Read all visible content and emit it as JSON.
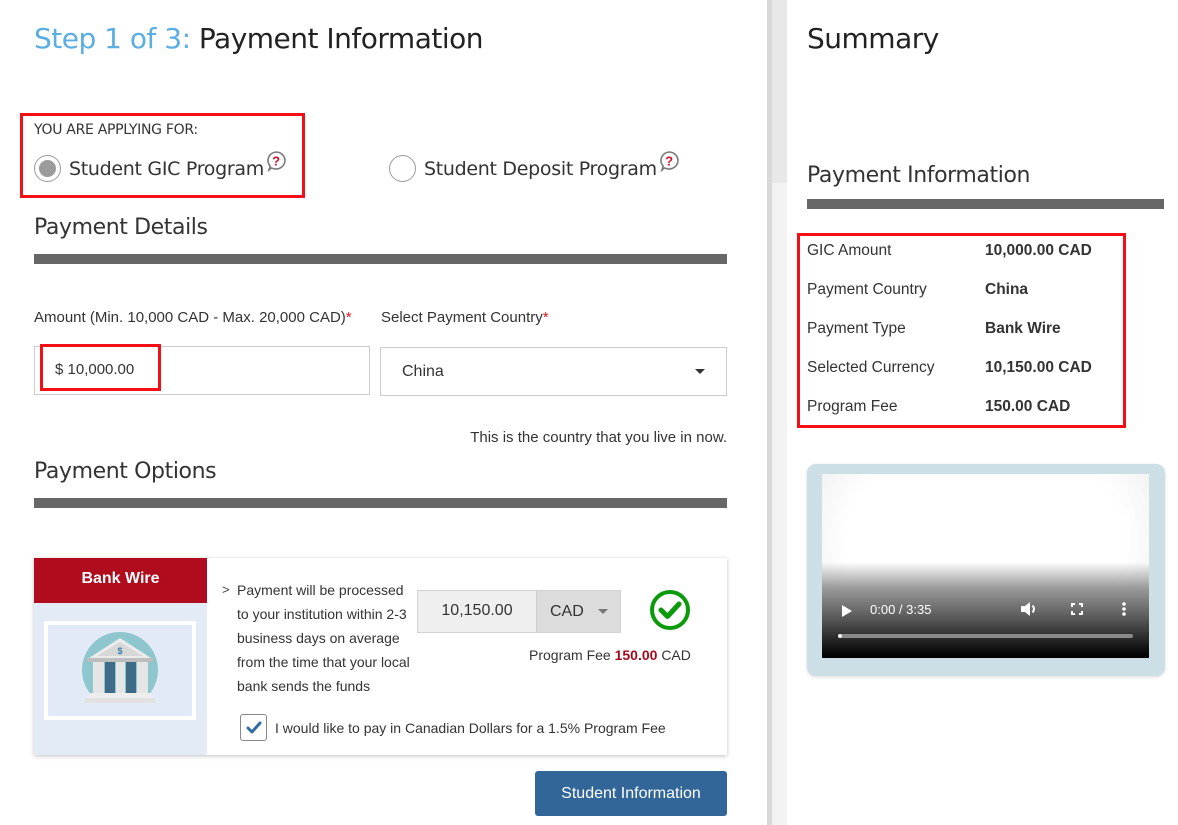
{
  "header": {
    "step_label": "Step 1 of 3:",
    "title": "Payment Information"
  },
  "applying": {
    "label": "YOU ARE APPLYING FOR:",
    "options": [
      {
        "label": "Student GIC Program",
        "selected": true,
        "help_icon": "help-bubble-icon"
      },
      {
        "label": "Student Deposit Program",
        "selected": false,
        "help_icon": "help-bubble-icon"
      }
    ]
  },
  "payment_details": {
    "title": "Payment Details",
    "amount_label": "Amount (Min. 10,000 CAD - Max. 20,000 CAD)",
    "country_label": "Select Payment Country",
    "required_mark": "*",
    "amount_value": "$ 10,000.00",
    "country_value": "China",
    "country_hint": "This is the country that you live in now."
  },
  "payment_options": {
    "title": "Payment Options",
    "option": {
      "name": "Bank Wire",
      "icon": "bank-building-icon",
      "arrow": ">",
      "description": "Payment will be processed to your institution within 2-3 business days on average from the time that your local bank sends the funds",
      "converted_amount": "10,150.00",
      "currency": "CAD",
      "status_icon": "check-circle-icon",
      "fee_prefix": "Program Fee",
      "fee_amount": "150.00",
      "fee_currency": "CAD",
      "cad_checkbox_label": "I would like to pay in Canadian Dollars for a 1.5% Program Fee",
      "cad_checkbox_checked": true
    }
  },
  "next_button": "Student Information",
  "summary": {
    "title": "Summary",
    "subtitle": "Payment Information",
    "rows": [
      {
        "label": "GIC Amount",
        "value": "10,000.00 CAD"
      },
      {
        "label": "Payment Country",
        "value": "China"
      },
      {
        "label": "Payment Type",
        "value": "Bank Wire"
      },
      {
        "label": "Selected Currency",
        "value": "10,150.00 CAD"
      },
      {
        "label": "Program Fee",
        "value": "150.00 CAD"
      }
    ]
  },
  "video": {
    "time": "0:00 / 3:35",
    "progress_fraction": 0.0
  },
  "colors": {
    "accent_blue": "#5aaee3",
    "bank_red": "#b00c1e",
    "button_blue": "#326699",
    "success_green": "#0a9a0a",
    "highlight_red": "#f20f15"
  }
}
